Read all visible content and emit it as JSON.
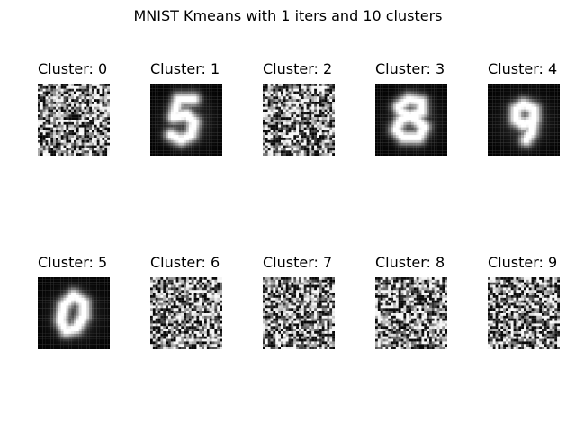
{
  "figure": {
    "title": "MNIST Kmeans with 1 iters and 10 clusters"
  },
  "clusters": [
    {
      "label": "Cluster: 0",
      "kind": "noise",
      "seed": 11
    },
    {
      "label": "Cluster: 1",
      "kind": "digit",
      "digit": "5",
      "seed": 23
    },
    {
      "label": "Cluster: 2",
      "kind": "noise",
      "seed": 37
    },
    {
      "label": "Cluster: 3",
      "kind": "digit",
      "digit": "8",
      "seed": 41
    },
    {
      "label": "Cluster: 4",
      "kind": "digit",
      "digit": "9",
      "seed": 53
    },
    {
      "label": "Cluster: 5",
      "kind": "digit",
      "digit": "0",
      "seed": 67
    },
    {
      "label": "Cluster: 6",
      "kind": "noise",
      "seed": 71
    },
    {
      "label": "Cluster: 7",
      "kind": "noise",
      "seed": 83
    },
    {
      "label": "Cluster: 8",
      "kind": "noise",
      "seed": 97
    },
    {
      "label": "Cluster: 9",
      "kind": "noise",
      "seed": 101
    }
  ],
  "colors": {
    "background": "#ffffff",
    "text": "#000000",
    "image_black": "#000000",
    "image_white": "#ffffff"
  }
}
